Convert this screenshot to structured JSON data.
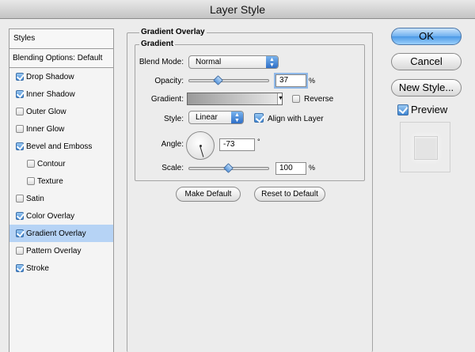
{
  "window": {
    "title": "Layer Style"
  },
  "styles_panel": {
    "header": "Styles",
    "blending_options": "Blending Options: Default",
    "items": [
      {
        "label": "Drop Shadow",
        "checked": true,
        "sub": false,
        "selected": false
      },
      {
        "label": "Inner Shadow",
        "checked": true,
        "sub": false,
        "selected": false
      },
      {
        "label": "Outer Glow",
        "checked": false,
        "sub": false,
        "selected": false
      },
      {
        "label": "Inner Glow",
        "checked": false,
        "sub": false,
        "selected": false
      },
      {
        "label": "Bevel and Emboss",
        "checked": true,
        "sub": false,
        "selected": false
      },
      {
        "label": "Contour",
        "checked": false,
        "sub": true,
        "selected": false
      },
      {
        "label": "Texture",
        "checked": false,
        "sub": true,
        "selected": false
      },
      {
        "label": "Satin",
        "checked": false,
        "sub": false,
        "selected": false
      },
      {
        "label": "Color Overlay",
        "checked": true,
        "sub": false,
        "selected": false
      },
      {
        "label": "Gradient Overlay",
        "checked": true,
        "sub": false,
        "selected": true
      },
      {
        "label": "Pattern Overlay",
        "checked": false,
        "sub": false,
        "selected": false
      },
      {
        "label": "Stroke",
        "checked": true,
        "sub": false,
        "selected": false
      }
    ]
  },
  "gradient_overlay": {
    "section_title": "Gradient Overlay",
    "group_title": "Gradient",
    "blend_mode_label": "Blend Mode:",
    "blend_mode_value": "Normal",
    "opacity_label": "Opacity:",
    "opacity_value": "37",
    "opacity_fraction": 0.37,
    "percent_unit": "%",
    "gradient_label": "Gradient:",
    "reverse_label": "Reverse",
    "reverse_checked": false,
    "style_label": "Style:",
    "style_value": "Linear",
    "align_label": "Align with Layer",
    "align_checked": true,
    "angle_label": "Angle:",
    "angle_value": "-73",
    "degree_unit": "°",
    "scale_label": "Scale:",
    "scale_value": "100",
    "scale_fraction": 0.5,
    "make_default_label": "Make Default",
    "reset_default_label": "Reset to Default"
  },
  "actions": {
    "ok_label": "OK",
    "cancel_label": "Cancel",
    "new_style_label": "New Style...",
    "preview_label": "Preview",
    "preview_checked": true
  },
  "colors": {
    "selection_highlight": "#b6d3f5",
    "accent_blue": "#4c99e6"
  }
}
